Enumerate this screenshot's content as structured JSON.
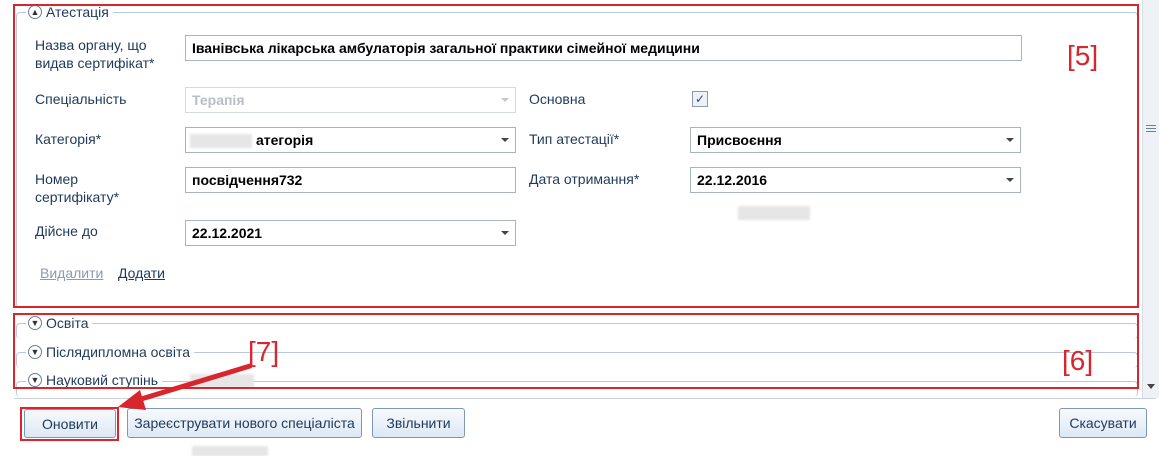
{
  "attestation": {
    "title": "Атестація",
    "fields": {
      "issuer_label": "Назва органу, що видав сертифікат*",
      "issuer_value": "Іванівська лікарська амбулаторія загальної практики сімейної медицини",
      "specialty_label": "Спеціальність",
      "specialty_value": "Терапія",
      "primary_label": "Основна",
      "primary_checked": true,
      "category_label": "Категорія*",
      "category_value": "атегорія",
      "attestation_type_label": "Тип атестації*",
      "attestation_type_value": "Присвоєння",
      "cert_number_label": "Номер сертифікату*",
      "cert_number_value": "посвідчення732",
      "received_date_label": "Дата отримання*",
      "received_date_value": "22.12.2016",
      "valid_until_label": "Дійсне до",
      "valid_until_value": "22.12.2021"
    },
    "delete_link": "Видалити",
    "add_link": "Додати"
  },
  "collapsed_sections": [
    "Освіта",
    "Післядипломна освіта",
    "Науковий ступінь"
  ],
  "buttons": {
    "update": "Оновити",
    "register": "Зареєструвати нового спеціаліста",
    "dismiss": "Звільнити",
    "cancel": "Скасувати"
  },
  "annotations": {
    "a5": "[5]",
    "a6": "[6]",
    "a7": "[7]",
    "color": "#d9262c"
  },
  "icons": {
    "collapse": "chevron-up-icon",
    "expand": "chevron-down-icon",
    "dropdown": "dropdown-arrow-icon",
    "check": "checkmark-icon"
  }
}
